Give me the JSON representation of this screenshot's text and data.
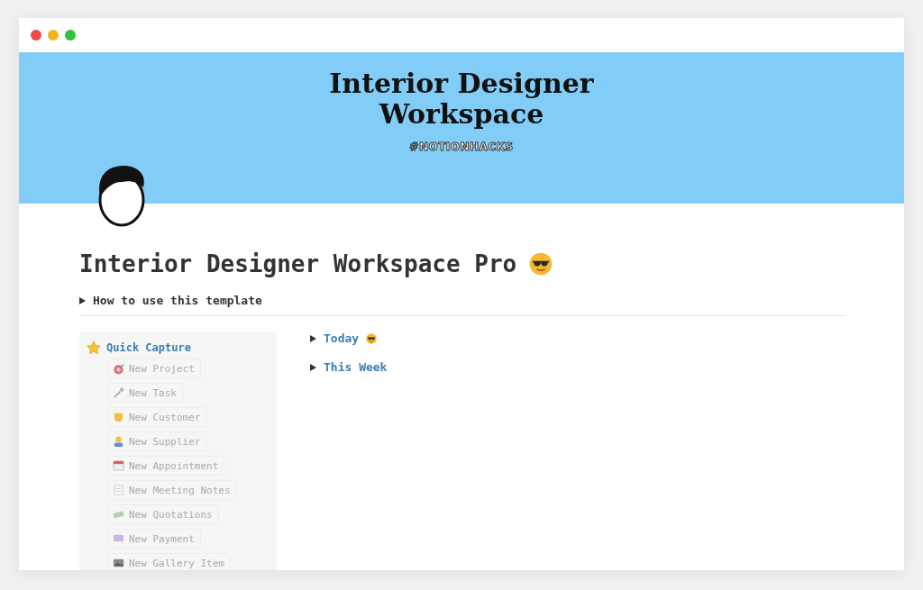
{
  "cover": {
    "title_lines": [
      "Interior Designer",
      "Workspace"
    ],
    "tag": "#NOTIONHACKS"
  },
  "page_title": "Interior Designer Workspace Pro",
  "intro_toggle": {
    "label": "How to use this template",
    "expanded": false
  },
  "quick_capture": {
    "title": "Quick Capture",
    "buttons": [
      "New Project",
      "New Task",
      "New Customer",
      "New Supplier",
      "New Appointment",
      "New Meeting Notes",
      "New Quotations",
      "New Payment",
      "New Gallery Item"
    ]
  },
  "toggles": [
    {
      "label": "Today",
      "expanded": false,
      "emoji": true
    },
    {
      "label": "This Week",
      "expanded": false,
      "emoji": false
    }
  ]
}
